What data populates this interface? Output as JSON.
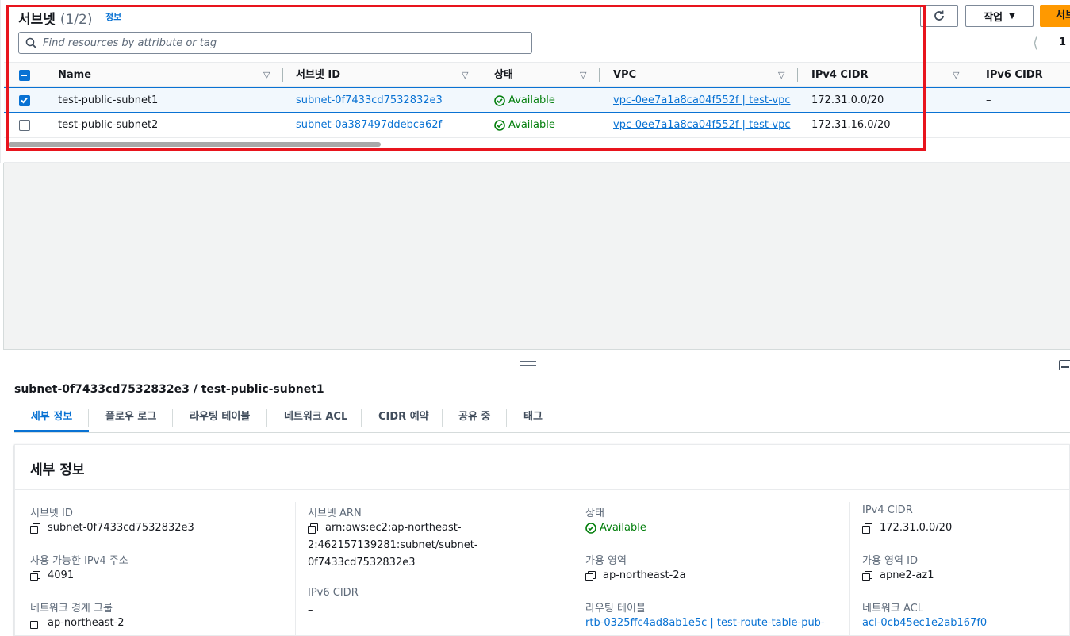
{
  "header": {
    "title": "서브넷",
    "count": "(1/2)",
    "info_link": "정보",
    "actions_label": "작업",
    "create_label": "서브넷 생성"
  },
  "search": {
    "placeholder": "Find resources by attribute or tag"
  },
  "pagination": {
    "current_page": "1"
  },
  "table": {
    "columns": [
      "Name",
      "서브넷 ID",
      "상태",
      "VPC",
      "IPv4 CIDR",
      "IPv6 CIDR"
    ],
    "rows": [
      {
        "selected": true,
        "name": "test-public-subnet1",
        "subnet_id": "subnet-0f7433cd7532832e3",
        "state": "Available",
        "vpc": "vpc-0ee7a1a8ca04f552f | test-vpc",
        "ipv4_cidr": "172.31.0.0/20",
        "ipv6_cidr": "–"
      },
      {
        "selected": false,
        "name": "test-public-subnet2",
        "subnet_id": "subnet-0a387497ddebca62f",
        "state": "Available",
        "vpc": "vpc-0ee7a1a8ca04f552f | test-vpc",
        "ipv4_cidr": "172.31.16.0/20",
        "ipv6_cidr": "–"
      }
    ]
  },
  "split_panel": {
    "title": "subnet-0f7433cd7532832e3 / test-public-subnet1",
    "tabs": [
      "세부 정보",
      "플로우 로그",
      "라우팅 테이블",
      "네트워크 ACL",
      "CIDR 예약",
      "공유 중",
      "태그"
    ],
    "active_tab": "세부 정보",
    "details_title": "세부 정보",
    "details": {
      "subnet_id_label": "서브넷 ID",
      "subnet_id": "subnet-0f7433cd7532832e3",
      "available_ipv4_label": "사용 가능한 IPv4 주소",
      "available_ipv4": "4091",
      "network_border_group_label": "네트워크 경계 그룹",
      "network_border_group": "ap-northeast-2",
      "subnet_arn_label": "서브넷 ARN",
      "subnet_arn_line1": "arn:aws:ec2:ap-northeast-",
      "subnet_arn_line2": "2:462157139281:subnet/subnet-",
      "subnet_arn_line3": "0f7433cd7532832e3",
      "ipv6_cidr_label": "IPv6 CIDR",
      "ipv6_cidr": "–",
      "state_label": "상태",
      "state": "Available",
      "availability_zone_label": "가용 영역",
      "availability_zone": "ap-northeast-2a",
      "route_table_label": "라우팅 테이블",
      "route_table": "rtb-0325ffc4ad8ab1e5c | test-route-table-pub-",
      "ipv4_cidr_label": "IPv4 CIDR",
      "ipv4_cidr": "172.31.0.0/20",
      "az_id_label": "가용 영역 ID",
      "az_id": "apne2-az1",
      "network_acl_label": "네트워크 ACL",
      "network_acl": "acl-0cb45ec1e2ab167f0"
    }
  },
  "colors": {
    "link": "#0972d3",
    "success": "#037f0c",
    "primary_button": "#ff9900",
    "highlight_box": "#e8141d"
  }
}
